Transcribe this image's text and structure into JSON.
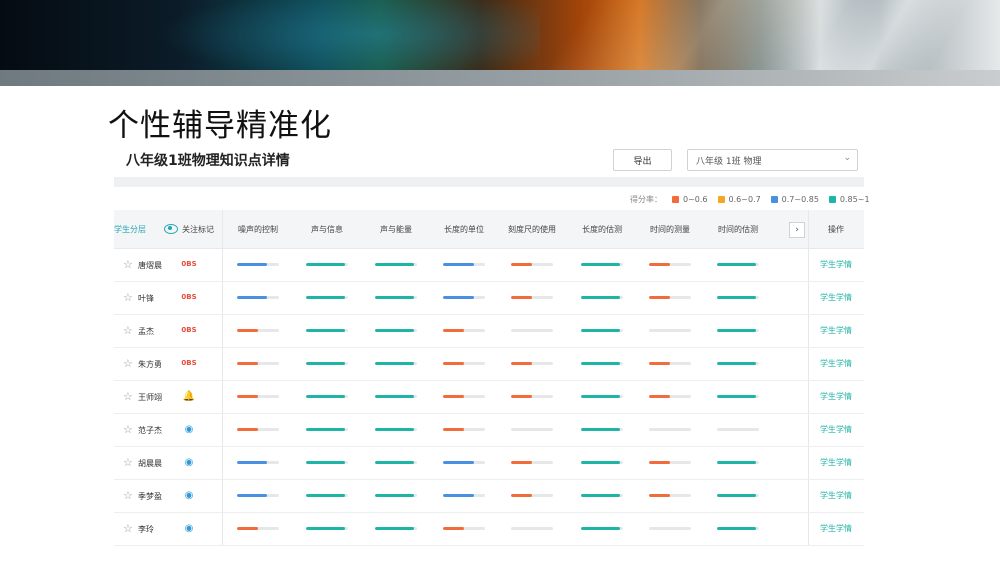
{
  "slide": {
    "title": "个性辅导精准化"
  },
  "card": {
    "title": "八年级1班物理知识点详情"
  },
  "toolbar": {
    "export_label": "导出",
    "class_select_value": "八年级 1班 物理"
  },
  "legend": {
    "label": "得分率：",
    "items": [
      {
        "label": "0~0.6",
        "color": "#f26b3a"
      },
      {
        "label": "0.6~0.7",
        "color": "#f5a623"
      },
      {
        "label": "0.7~0.85",
        "color": "#4a90e2"
      },
      {
        "label": "0.85~1",
        "color": "#1fb5a6"
      }
    ]
  },
  "table": {
    "layer_header": "学生分层",
    "follow_header": "关注标记",
    "columns": [
      "噪声的控制",
      "声与信息",
      "声与能量",
      "长度的单位",
      "刻度尺的使用",
      "长度的估测",
      "时间的测量",
      "时间的估测"
    ],
    "next_icon": "chevron-right-icon",
    "op_header": "操作",
    "op_link_label": "学生学情",
    "rows": [
      {
        "name": "唐熠晨",
        "badge": "red",
        "badge_text": "0BS",
        "scores": [
          0.72,
          0.92,
          0.92,
          0.74,
          0.5,
          0.92,
          0.5,
          0.92
        ]
      },
      {
        "name": "叶锋",
        "badge": "red",
        "badge_text": "0BS",
        "scores": [
          0.72,
          0.92,
          0.92,
          0.74,
          0.5,
          0.92,
          0.5,
          0.92
        ]
      },
      {
        "name": "孟杰",
        "badge": "red",
        "badge_text": "0BS",
        "scores": [
          0.5,
          0.92,
          0.92,
          0.5,
          0,
          0.92,
          0,
          0.92
        ]
      },
      {
        "name": "朱方勇",
        "badge": "red",
        "badge_text": "0BS",
        "scores": [
          0.5,
          0.92,
          0.92,
          0.5,
          0.5,
          0.92,
          0.5,
          0.92
        ]
      },
      {
        "name": "王师翊",
        "badge": "bell",
        "badge_text": "🔔",
        "scores": [
          0.5,
          0.92,
          0.92,
          0.5,
          0.5,
          0.92,
          0.5,
          0.92
        ]
      },
      {
        "name": "范子杰",
        "badge": "blue",
        "badge_text": "◉",
        "scores": [
          0.5,
          0.92,
          0.92,
          0.5,
          0,
          0.92,
          0,
          0
        ]
      },
      {
        "name": "胡晨晨",
        "badge": "blue",
        "badge_text": "◉",
        "scores": [
          0.72,
          0.92,
          0.92,
          0.74,
          0.5,
          0.92,
          0.5,
          0.92
        ]
      },
      {
        "name": "季梦盈",
        "badge": "blue",
        "badge_text": "◉",
        "scores": [
          0.72,
          0.92,
          0.92,
          0.74,
          0.5,
          0.92,
          0.5,
          0.92
        ]
      },
      {
        "name": "李玲",
        "badge": "blue",
        "badge_text": "◉",
        "scores": [
          0.5,
          0.92,
          0.92,
          0.5,
          0,
          0.92,
          0,
          0.92
        ]
      }
    ]
  }
}
